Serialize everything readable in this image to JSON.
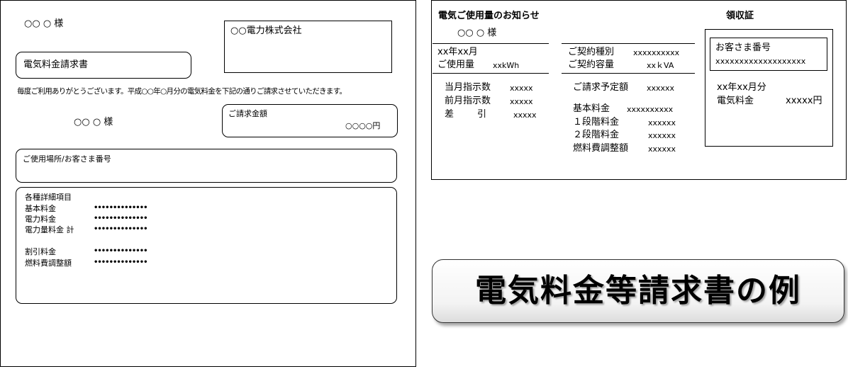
{
  "invoice": {
    "recipient_top": "○○ ○  様",
    "company": "○○電力株式会社",
    "title": "電気料金請求書",
    "greeting": "毎度ご利用ありがとうございます。平成○○年○月分の電気料金を下記の通りご請求させていただきます。",
    "recipient_mid": "○○ ○  様",
    "billing_amount_label": "ご請求金額",
    "billing_amount_value": "○○○○円",
    "location_label": "ご使用場所/お客さま番号",
    "details_heading": "各種詳細項目",
    "details": [
      {
        "label": "基本料金",
        "value": "••••••••••••••"
      },
      {
        "label": "電力料金",
        "value": "••••••••••••••"
      },
      {
        "label": "電力量料金  計",
        "value": "••••••••••••••"
      },
      {
        "label": "割引料金",
        "value": "••••••••••••••"
      },
      {
        "label": "燃料費調整額",
        "value": "••••••••••••••"
      }
    ]
  },
  "notice": {
    "title": "電気ご使用量のお知らせ",
    "recipient": "○○ ○  様",
    "month": "xx年xx月",
    "usage_label": "ご使用量",
    "usage_value": "xxkWh",
    "contract_type_label": "ご契約種別",
    "contract_type_value": "xxxxxxxxxx",
    "contract_capacity_label": "ご契約容量",
    "contract_capacity_value": "xxｋVA",
    "meter_current_label": "当月指示数",
    "meter_current_value": "xxxxx",
    "meter_prev_label": "前月指示数",
    "meter_prev_value": "xxxxx",
    "meter_diff_label": "差        引",
    "meter_diff_value": "xxxxx",
    "scheduled_label": "ご請求予定額",
    "scheduled_value": "xxxxxx",
    "charges": [
      {
        "label": "基本料金",
        "value": "xxxxxxxxxx"
      },
      {
        "label": "１段階料金",
        "value": "xxxxxx"
      },
      {
        "label": "２段階料金",
        "value": "xxxxxx"
      },
      {
        "label": "燃料費調整額",
        "value": "xxxxxx"
      }
    ]
  },
  "receipt": {
    "title": "領収証",
    "customer_number_label": "お客さま番号",
    "customer_number_value": "xxxxxxxxxxxxxxxxxxx",
    "period": "xx年xx月分",
    "charge_label": "電気料金",
    "charge_value": "xxxxx円"
  },
  "page_title": "電気料金等請求書の例"
}
